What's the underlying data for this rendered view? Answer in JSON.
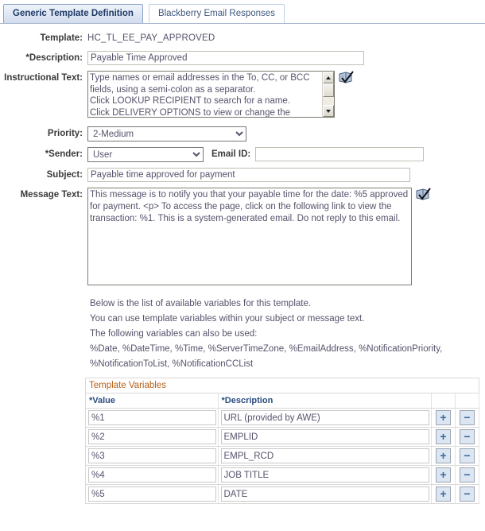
{
  "tabs": [
    {
      "label": "Generic Template Definition",
      "active": true
    },
    {
      "label": "Blackberry Email Responses",
      "active": false
    }
  ],
  "form": {
    "template_label": "Template:",
    "template_value": "HC_TL_EE_PAY_APPROVED",
    "description_label": "*Description:",
    "description_value": "Payable Time Approved",
    "instructional_label": "Instructional Text:",
    "instructional_value": "Type names or email addresses in the To, CC, or BCC fields, using a semi-colon as a separator.\nClick LOOKUP RECIPIENT to search for a name.\nClick DELIVERY OPTIONS to view or change the",
    "priority_label": "Priority:",
    "priority_value": "2-Medium",
    "priority_options": [
      "2-Medium"
    ],
    "sender_label": "*Sender:",
    "sender_value": "User",
    "sender_options": [
      "User"
    ],
    "email_id_label": "Email ID:",
    "email_id_value": "",
    "subject_label": "Subject:",
    "subject_value": "Payable time approved for payment",
    "message_label": "Message Text:",
    "message_value": "This message is to notify you that your payable time for the date: %5 approved for payment. <p> To access the page, click on the following link to view the transaction: %1. This is a system-generated email. Do not reply to this email."
  },
  "info_lines": [
    "Below is the list of available variables for this template.",
    "You can use template variables within your subject or message text.",
    "The following variables can also be used:",
    "%Date, %DateTime, %Time, %ServerTimeZone, %EmailAddress, %NotificationPriority,",
    "%NotificationToList, %NotificationCCList"
  ],
  "grid": {
    "title": "Template Variables",
    "columns": [
      "*Value",
      "*Description"
    ],
    "add_label": "+",
    "delete_label": "−",
    "rows": [
      {
        "value": "%1",
        "description": "URL (provided by AWE)"
      },
      {
        "value": "%2",
        "description": "EMPLID"
      },
      {
        "value": "%3",
        "description": "EMPL_RCD"
      },
      {
        "value": "%4",
        "description": "JOB TITLE"
      },
      {
        "value": "%5",
        "description": "DATE"
      }
    ]
  },
  "colors": {
    "tab_active_text": "#1f3a66",
    "tab_inactive_text": "#41597f",
    "grid_title": "#b45f16",
    "grid_header_text": "#2a4d80",
    "field_text": "#55536b",
    "button_accent": "#37689e"
  }
}
